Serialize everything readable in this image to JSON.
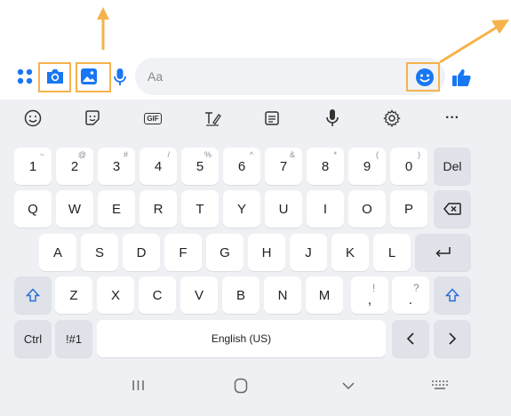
{
  "compose": {
    "placeholder": "Aa",
    "icons": [
      "apps-grid-icon",
      "camera-icon",
      "gallery-icon",
      "microphone-icon",
      "emoji-icon",
      "thumbs-up-icon"
    ],
    "accent": "#1877f2"
  },
  "keyboard": {
    "toolbar": [
      "emoji-icon",
      "sticker-icon",
      "gif-icon",
      "handwriting-icon",
      "clipboard-icon",
      "voice-input-icon",
      "settings-icon",
      "more-icon"
    ],
    "gif_label": "GIF",
    "more_label": "···",
    "row1": [
      {
        "k": "1",
        "s": "~"
      },
      {
        "k": "2",
        "s": "@"
      },
      {
        "k": "3",
        "s": "#"
      },
      {
        "k": "4",
        "s": "/"
      },
      {
        "k": "5",
        "s": "%"
      },
      {
        "k": "6",
        "s": "^"
      },
      {
        "k": "7",
        "s": "&"
      },
      {
        "k": "8",
        "s": "*"
      },
      {
        "k": "9",
        "s": "("
      },
      {
        "k": "0",
        "s": ")"
      }
    ],
    "del_label": "Del",
    "row2": [
      "Q",
      "W",
      "E",
      "R",
      "T",
      "Y",
      "U",
      "I",
      "O",
      "P"
    ],
    "row3": [
      "A",
      "S",
      "D",
      "F",
      "G",
      "H",
      "J",
      "K",
      "L"
    ],
    "row4": [
      "Z",
      "X",
      "C",
      "V",
      "B",
      "N",
      "M"
    ],
    "comma": {
      "k": ",",
      "s": "!"
    },
    "period": {
      "k": ".",
      "s": "?"
    },
    "ctrl_label": "Ctrl",
    "symbols_label": "!#1",
    "space_label": "English (US)",
    "nav": {
      "recents": "III",
      "home": "◯",
      "back": "∨"
    }
  },
  "colors": {
    "annotation": "#f6b24b",
    "key": "#ffffff",
    "keyboard_bg": "#eef0f4",
    "shift_blue": "#2a6fdb"
  }
}
